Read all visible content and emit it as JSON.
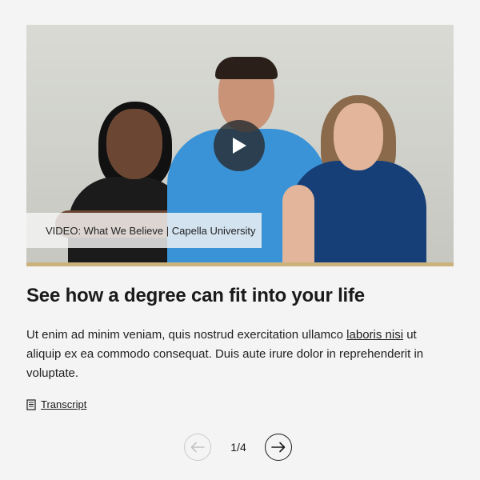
{
  "video": {
    "caption": "VIDEO: What We Believe | Capella University",
    "play_icon": "play-icon",
    "accent_bar_color": "#cbb27c"
  },
  "content": {
    "heading": "See how a degree can fit into your life",
    "paragraph_part1": "Ut enim ad minim veniam, quis nostrud exercitation ullamco ",
    "paragraph_link": "laboris nisi",
    "paragraph_part2": " ut aliquip ex ea commodo consequat. Duis aute irure dolor in reprehenderit in voluptate."
  },
  "transcript": {
    "label": "Transcript",
    "icon": "document-icon"
  },
  "pager": {
    "current": "1/4",
    "prev_icon": "arrow-left-icon",
    "next_icon": "arrow-right-icon"
  }
}
